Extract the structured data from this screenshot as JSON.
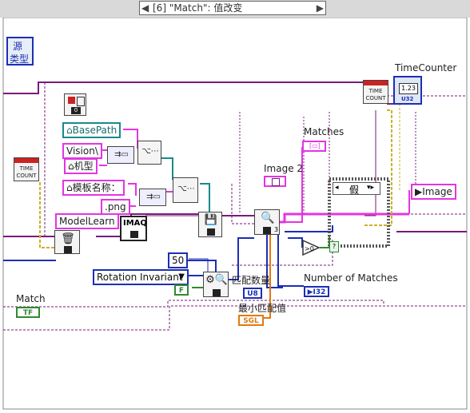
{
  "case_structure": {
    "selector": "[6] \"Match\": 值改变",
    "left_arrow": "◀",
    "right_arrow": "▶"
  },
  "source_box": {
    "line1": "源",
    "line2": "类型"
  },
  "constants": {
    "base_path": "BasePath",
    "vision": "Vision\\",
    "model_type": "机型",
    "template_name": "模板名称：",
    "png": ".png",
    "model_learn": "ModelLearn",
    "fifty": "50",
    "rotation": "Rotation Invariant",
    "rotation_arrow": "▼",
    "false_const": "F",
    "false_case": "假"
  },
  "labels": {
    "time_counter": "TimeCounter",
    "matches": "Matches",
    "image2": "Image 2",
    "image_out": "Image",
    "number_of_matches": "Number of Matches",
    "match": "Match",
    "match_count": "匹配数量",
    "min_match_value": "最小匹配值",
    "time_count_a": "TIME",
    "time_count_b": "COUNT",
    "imaq": "IMAQ",
    "u32_tag": "U32",
    "i32_tag": "I32",
    "u8_tag": "U8",
    "sgl_tag": "SGL",
    "tf_tag": "TF",
    "counter_val": "1.23",
    "zero": "0",
    "three": "3",
    "match_score_tag": "0"
  },
  "colors": {
    "pink_wire": "#e236e2",
    "purple_wire": "#7a1a7a",
    "teal_wire": "#1a8a8a",
    "blue_wire": "#1b2fb5",
    "orange_wire": "#e07a10",
    "green_wire": "#2f8a2f",
    "yellow_wire": "#c9b226"
  }
}
